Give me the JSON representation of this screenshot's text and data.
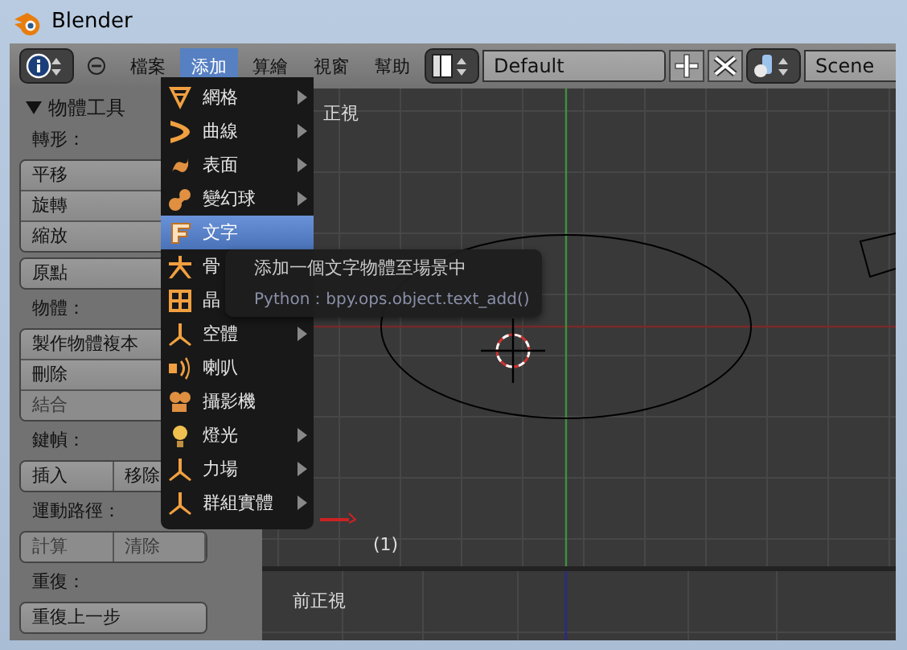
{
  "window": {
    "title": "Blender"
  },
  "header": {
    "menus": [
      {
        "label": "檔案",
        "selected": false
      },
      {
        "label": "添加",
        "selected": true
      },
      {
        "label": "算繪",
        "selected": false
      },
      {
        "label": "視窗",
        "selected": false
      },
      {
        "label": "幫助",
        "selected": false
      }
    ],
    "screen": {
      "value": "Default"
    },
    "scene": {
      "value": "Scene"
    }
  },
  "tool_panel": {
    "title": "物體工具",
    "expanded": true,
    "sections": [
      {
        "label": "轉形：",
        "kind": "column",
        "buttons": [
          {
            "label": "平移",
            "disabled": false
          },
          {
            "label": "旋轉",
            "disabled": false
          },
          {
            "label": "縮放",
            "disabled": false
          }
        ]
      },
      {
        "kind": "column",
        "buttons": [
          {
            "label": "原點",
            "disabled": false
          }
        ]
      },
      {
        "label": "物體：",
        "kind": "column",
        "buttons": [
          {
            "label": "製作物體複本",
            "disabled": false
          },
          {
            "label": "刪除",
            "disabled": false
          },
          {
            "label": "結合",
            "disabled": true
          }
        ]
      },
      {
        "label": "鍵幀：",
        "kind": "row",
        "buttons": [
          {
            "label": "插入",
            "disabled": false
          },
          {
            "label": "移除",
            "disabled": false
          }
        ]
      },
      {
        "label": "運動路徑：",
        "kind": "row",
        "buttons": [
          {
            "label": "計算",
            "disabled": true
          },
          {
            "label": "清除",
            "disabled": true
          }
        ]
      },
      {
        "label": "重復：",
        "kind": "column",
        "buttons": [
          {
            "label": "重復上一步",
            "disabled": false
          }
        ]
      }
    ]
  },
  "viewports": [
    {
      "label": "正視",
      "frame": "(1)"
    },
    {
      "label": "前正視"
    }
  ],
  "add_menu": {
    "items": [
      {
        "label": "網格",
        "kind": "mesh",
        "submenu": true,
        "selected": false
      },
      {
        "label": "曲線",
        "kind": "curve",
        "submenu": true,
        "selected": false
      },
      {
        "label": "表面",
        "kind": "surface",
        "submenu": true,
        "selected": false
      },
      {
        "label": "變幻球",
        "kind": "metaball",
        "submenu": true,
        "selected": false
      },
      {
        "label": "文字",
        "kind": "text",
        "submenu": false,
        "selected": true
      },
      {
        "label": "骨",
        "kind": "armature",
        "submenu": false,
        "selected": false
      },
      {
        "label": "晶",
        "kind": "lattice",
        "submenu": false,
        "selected": false
      },
      {
        "label": "空體",
        "kind": "empty",
        "submenu": true,
        "selected": false
      },
      {
        "label": "喇叭",
        "kind": "speaker",
        "submenu": false,
        "selected": false
      },
      {
        "label": "攝影機",
        "kind": "camera",
        "submenu": false,
        "selected": false
      },
      {
        "label": "燈光",
        "kind": "lamp",
        "submenu": true,
        "selected": false
      },
      {
        "label": "力場",
        "kind": "empty",
        "submenu": true,
        "selected": false
      },
      {
        "label": "群組實體",
        "kind": "empty",
        "submenu": true,
        "selected": false
      }
    ]
  },
  "tooltip": {
    "text": "添加一個文字物體至場景中",
    "python": "Python：bpy.ops.object.text_add()"
  }
}
